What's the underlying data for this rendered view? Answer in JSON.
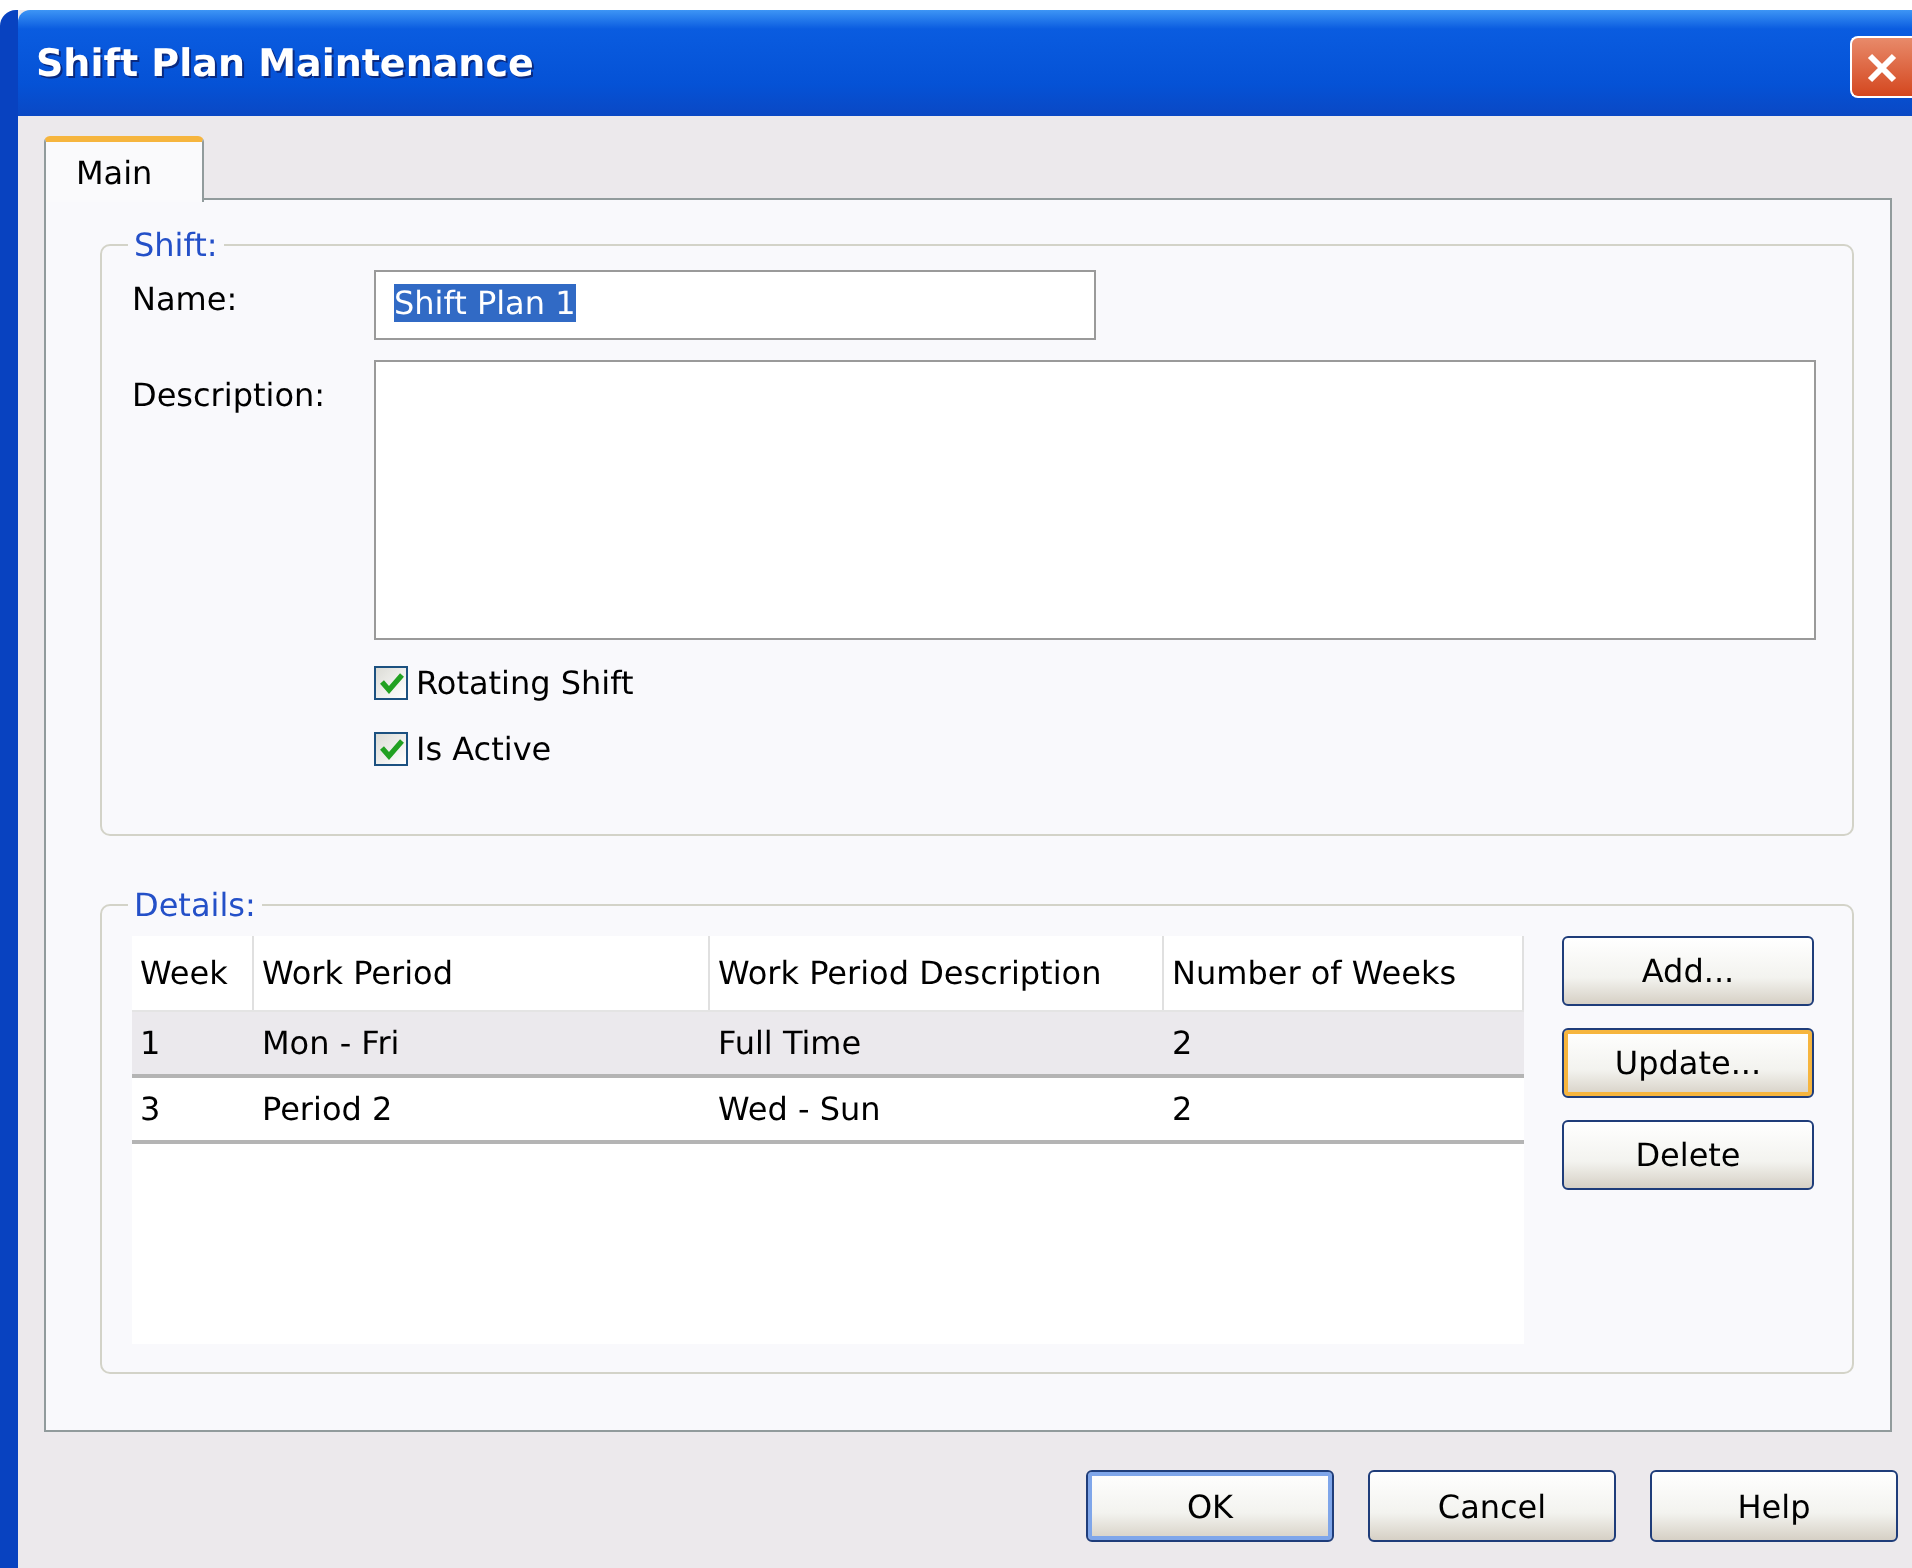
{
  "window": {
    "title": "Shift Plan Maintenance"
  },
  "tabs": [
    {
      "label": "Main",
      "selected": true
    }
  ],
  "shift": {
    "legend": "Shift:",
    "name": {
      "label": "Name:",
      "value": "Shift Plan 1",
      "selected": true
    },
    "description": {
      "label": "Description:"
    },
    "checkboxes": [
      {
        "label": "Rotating Shift",
        "checked": true
      },
      {
        "label": "Is Active",
        "checked": true
      }
    ]
  },
  "details": {
    "legend": "Details:",
    "table": {
      "columns": [
        "Week",
        "Work Period",
        "Work Period Description",
        "Number of Weeks"
      ],
      "rows": [
        {
          "cells": [
            "1",
            "Mon - Fri",
            "Full Time",
            "2"
          ],
          "selected": true
        },
        {
          "cells": [
            "3",
            "Period 2",
            "Wed - Sun",
            "2"
          ],
          "selected": false
        }
      ]
    },
    "buttons": [
      {
        "label": "Add...",
        "focused": false
      },
      {
        "label": "Update...",
        "focused": true
      },
      {
        "label": "Delete",
        "focused": false
      }
    ]
  },
  "dialog_buttons": [
    {
      "label": "OK",
      "default": true
    },
    {
      "label": "Cancel",
      "default": false
    },
    {
      "label": "Help",
      "default": false
    }
  ]
}
